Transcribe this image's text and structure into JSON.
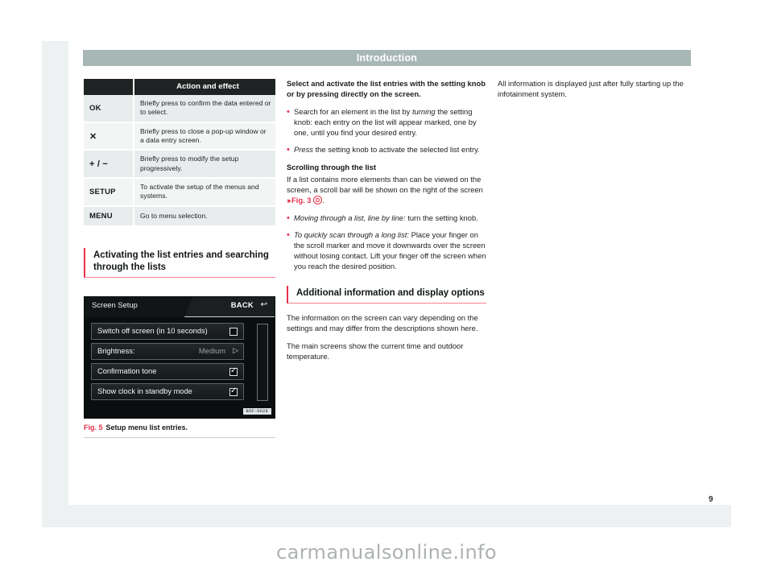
{
  "header": {
    "title": "Introduction"
  },
  "page": {
    "number": "9"
  },
  "watermark": "carmanualsonline.info",
  "table": {
    "headers": [
      "",
      "Action and effect"
    ],
    "rows": [
      {
        "key": "OK",
        "desc": "Briefly press to confirm the data entered or to select."
      },
      {
        "key": "✕",
        "desc": "Briefly press to close a pop-up window or a data entry screen."
      },
      {
        "key": "+ / −",
        "desc": "Briefly press to modify the setup progressively."
      },
      {
        "key": "SETUP",
        "desc": "To activate the setup of the menus and systems."
      },
      {
        "key": "MENU",
        "desc": "Go to menu selection."
      }
    ]
  },
  "section_activating": {
    "heading": "Activating the list entries and searching through the lists"
  },
  "figure": {
    "screen_title": "Screen Setup",
    "back_label": "BACK",
    "back_icon": "↩",
    "image_code": "B5F-0628",
    "rows": [
      {
        "label": "Switch off screen (in 10 seconds)",
        "value": "",
        "control": "checkbox",
        "checked": false
      },
      {
        "label": "Brightness:",
        "value": "Medium",
        "control": "arrow",
        "checked": false
      },
      {
        "label": "Confirmation tone",
        "value": "",
        "control": "checkbox",
        "checked": true
      },
      {
        "label": "Show clock in standby mode",
        "value": "",
        "control": "checkbox",
        "checked": true
      }
    ],
    "caption_number": "Fig. 5",
    "caption_text": "Setup menu list entries."
  },
  "middle": {
    "intro_bold": "Select and activate the list entries with the setting knob or by pressing directly on the screen.",
    "bullet1_pre": "Search for an element in the list by ",
    "bullet1_ital": "turning",
    "bullet1_post": " the setting knob: each entry on the list will appear marked, one by one, until you find your desired entry.",
    "bullet2_ital": "Press",
    "bullet2_post": " the setting knob to activate the selected list entry.",
    "scroll_heading": "Scrolling through the list",
    "scroll_para_pre": "If a list contains more elements than can be viewed on the screen, a scroll bar will be shown on the right of the screen ",
    "scroll_ref_chevrons": "›››",
    "scroll_ref_fig": "Fig. 3",
    "scroll_ref_circle": "D",
    "scroll_para_post": ".",
    "bullet3_ital": "Moving through a list, line by line:",
    "bullet3_post": " turn the setting knob.",
    "bullet4_ital": "To quickly scan through a long list:",
    "bullet4_post": " Place your finger on the scroll marker and move it downwards over the screen without losing contact. Lift your finger off the screen when you reach the desired position.",
    "additional_heading": "Additional information and display options",
    "additional_p1": "The information on the screen can vary depending on the settings and may differ from the descriptions shown here.",
    "additional_p2": "The main screens show the current time and outdoor temperature."
  },
  "right": {
    "p1": "All information is displayed just after fully starting up the infotainment system."
  }
}
